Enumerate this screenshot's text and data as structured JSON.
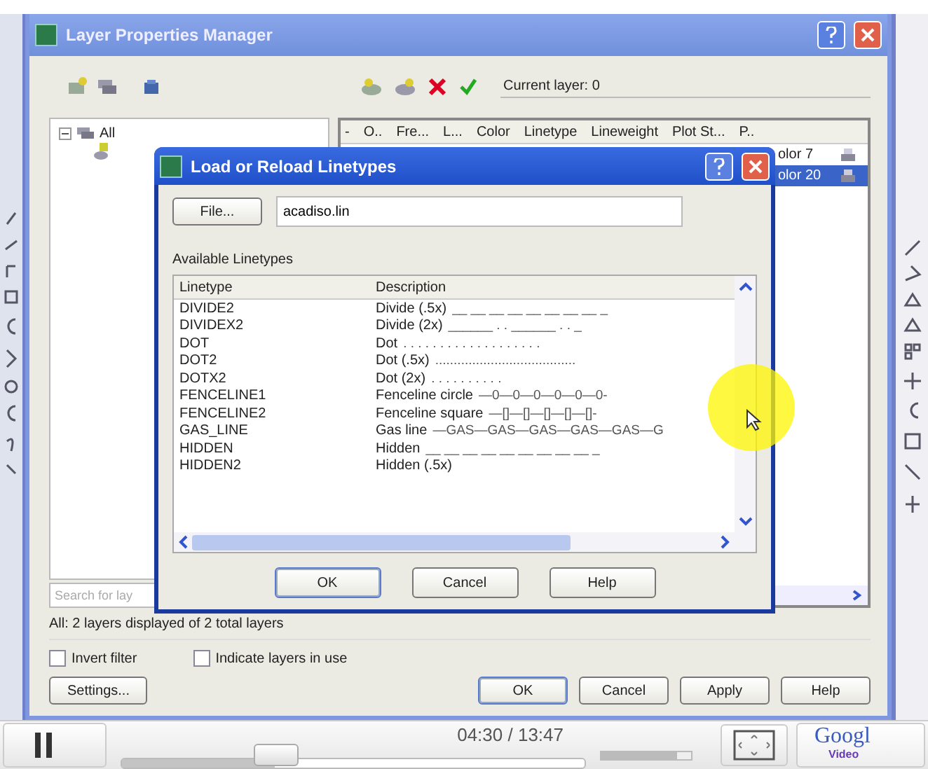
{
  "layer_window": {
    "title": "Layer Properties Manager",
    "current_layer": "Current layer: 0",
    "tree": [
      {
        "label": "All",
        "expanded": true
      }
    ],
    "columns": [
      "-",
      "O..",
      "Fre...",
      "L...",
      "Color",
      "Linetype",
      "Lineweight",
      "Plot St...",
      "P.."
    ],
    "rows": [
      {
        "plot_style": "olor 7",
        "selected": false
      },
      {
        "plot_style": "olor 20",
        "selected": true
      }
    ],
    "search": {
      "placeholder": "Search for lay"
    },
    "status": "All: 2 layers displayed of 2 total layers",
    "checkboxes": [
      {
        "label": "Invert filter",
        "checked": false
      },
      {
        "label": "Indicate layers in use",
        "checked": false
      }
    ],
    "settings_button": "Settings...",
    "buttons": [
      "OK",
      "Cancel",
      "Apply",
      "Help"
    ]
  },
  "dialog": {
    "title": "Load or Reload Linetypes",
    "file_button": "File...",
    "file": "acadiso.lin",
    "list_label": "Available Linetypes",
    "columns": [
      "Linetype",
      "Description"
    ],
    "rows": [
      {
        "name": "DIVIDE2",
        "description": "Divide (.5x)",
        "pattern": "__ __ __ __ __ __ __ __ _"
      },
      {
        "name": "DIVIDEX2",
        "description": "Divide (2x)",
        "pattern": "______ . . ______ . . _"
      },
      {
        "name": "DOT",
        "description": "Dot",
        "pattern": ". . . . . . . . . . . . . . . . . . ."
      },
      {
        "name": "DOT2",
        "description": "Dot (.5x)",
        "pattern": "......................................"
      },
      {
        "name": "DOTX2",
        "description": "Dot (2x)",
        "pattern": ".  .  .  .  .  .  .  .  .  ."
      },
      {
        "name": "FENCELINE1",
        "description": "Fenceline circle",
        "pattern": "—0—0—0—0—0—0-"
      },
      {
        "name": "FENCELINE2",
        "description": "Fenceline square",
        "pattern": "—[]—[]—[]—[]—[]-"
      },
      {
        "name": "GAS_LINE",
        "description": "Gas line",
        "pattern": "—GAS—GAS—GAS—GAS—GAS—G"
      },
      {
        "name": "HIDDEN",
        "description": "Hidden",
        "pattern": "__ __ __ __ __ __ __ __ __ _"
      },
      {
        "name": "HIDDEN2",
        "description": "Hidden (.5x)",
        "pattern": ""
      }
    ],
    "buttons": [
      "OK",
      "Cancel",
      "Help"
    ]
  },
  "player": {
    "playing": true,
    "time": "04:30 / 13:47",
    "progress": {
      "level": 0.33
    },
    "volume": {
      "level": 0.85
    },
    "logo": [
      "Googl",
      "Video"
    ]
  }
}
